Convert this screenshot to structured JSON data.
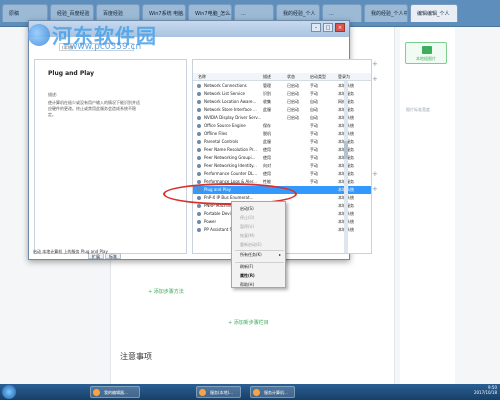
{
  "watermark": {
    "text": "河东软件园",
    "url": "www.pc0359.cn"
  },
  "browser": {
    "tabs": [
      "原稿",
      "经验_百度经验",
      "百度经验",
      "Win7系统 电脑...",
      "Win7电脑_怎么...",
      "...",
      "我的经验_个人",
      "...",
      "我的经验_个人中",
      "编辑编辑_个人"
    ]
  },
  "webpage": {
    "add_step": "+ 添加步骤方法",
    "add_section": "+ 添加新步骤栏目",
    "notes_heading": "注意事项",
    "side_button": "本地插图片",
    "side_note": "图片标准宽度"
  },
  "window": {
    "address": "(本地)",
    "left_title": "Plug and Play",
    "left_desc_label": "描述:",
    "left_desc": "使计算机在极少或没有用户输入的情况下能识别并适应硬件的更改。终止或禁用此服务会造成系统不稳定。",
    "bottom_tabs": [
      "扩展",
      "标准"
    ],
    "status": "启动 本地计算机 上的服务 Plug and Play",
    "columns": [
      "名称",
      "描述",
      "状态",
      "启动类型",
      "登录为"
    ],
    "services": [
      {
        "name": "Network Connections",
        "desc": "管理",
        "status": "已启动",
        "startup": "手动",
        "logon": "本地系统"
      },
      {
        "name": "Network List Service",
        "desc": "识别",
        "status": "已启动",
        "startup": "手动",
        "logon": "本地服务"
      },
      {
        "name": "Network Location Aware...",
        "desc": "收集",
        "status": "已启动",
        "startup": "自动",
        "logon": "网络服务"
      },
      {
        "name": "Network Store Interface ...",
        "desc": "此服",
        "status": "已启动",
        "startup": "自动",
        "logon": "本地服务"
      },
      {
        "name": "NVIDIA Display Driver Serv...",
        "desc": "",
        "status": "已启动",
        "startup": "自动",
        "logon": "本地系统"
      },
      {
        "name": "Office Source Engine",
        "desc": "保存",
        "status": "",
        "startup": "手动",
        "logon": "本地系统"
      },
      {
        "name": "Offline Files",
        "desc": "脱机",
        "status": "",
        "startup": "手动",
        "logon": "本地系统"
      },
      {
        "name": "Parental Controls",
        "desc": "此服",
        "status": "",
        "startup": "手动",
        "logon": "本地服务"
      },
      {
        "name": "Peer Name Resolution Pr...",
        "desc": "使用",
        "status": "",
        "startup": "手动",
        "logon": "本地服务"
      },
      {
        "name": "Peer Networking Groupi...",
        "desc": "使用",
        "status": "",
        "startup": "手动",
        "logon": "本地服务"
      },
      {
        "name": "Peer Networking Identity...",
        "desc": "向对",
        "status": "",
        "startup": "手动",
        "logon": "本地服务"
      },
      {
        "name": "Performance Counter DL...",
        "desc": "使用",
        "status": "",
        "startup": "手动",
        "logon": "本地服务"
      },
      {
        "name": "Performance Logs & Aler...",
        "desc": "性能",
        "status": "",
        "startup": "手动",
        "logon": "本地服务"
      },
      {
        "name": "Plug and Play",
        "desc": "",
        "status": "",
        "startup": "",
        "logon": "本地系统"
      },
      {
        "name": "PnP-X IP Bus Enumerat...",
        "desc": "",
        "status": "",
        "startup": "",
        "logon": "本地系统"
      },
      {
        "name": "PNRP Machine Name",
        "desc": "",
        "status": "",
        "startup": "",
        "logon": "本地服务"
      },
      {
        "name": "Portable Device Enum...",
        "desc": "",
        "status": "",
        "startup": "",
        "logon": "本地系统"
      },
      {
        "name": "Power",
        "desc": "",
        "status": "",
        "startup": "",
        "logon": "本地系统"
      },
      {
        "name": "PP Assistant Service",
        "desc": "",
        "status": "",
        "startup": "",
        "logon": "本地系统"
      }
    ]
  },
  "context_menu": [
    {
      "label": "启动(S)",
      "disabled": false,
      "bold": false
    },
    {
      "label": "停止(O)",
      "disabled": true,
      "bold": false
    },
    {
      "label": "暂停(U)",
      "disabled": true,
      "bold": false
    },
    {
      "label": "恢复(M)",
      "disabled": true,
      "bold": false
    },
    {
      "label": "重新启动(E)",
      "disabled": true,
      "bold": false
    },
    {
      "label": "所有任务(K)",
      "disabled": false,
      "bold": false,
      "submenu": true
    },
    {
      "label": "刷新(F)",
      "disabled": false,
      "bold": false
    },
    {
      "label": "属性(R)",
      "disabled": false,
      "bold": true
    },
    {
      "label": "帮助(H)",
      "disabled": false,
      "bold": false
    }
  ],
  "taskbar": {
    "items": [
      "我的编辑器...",
      "服务(本地)...",
      "服务计算机..."
    ],
    "clock_time": "9:50",
    "clock_date": "2017/10/18"
  }
}
